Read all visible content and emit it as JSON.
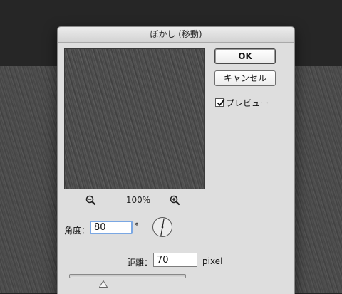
{
  "dialog": {
    "title": "ぼかし (移動)"
  },
  "buttons": {
    "ok_label": "OK",
    "cancel_label": "キャンセル"
  },
  "preview_toggle": {
    "label": "プレビュー",
    "checked": true
  },
  "zoom": {
    "level": "100%",
    "zoom_out_icon": "zoom-out-icon",
    "zoom_in_icon": "zoom-in-icon"
  },
  "angle": {
    "label": "角度：",
    "value": "80",
    "unit": "°"
  },
  "distance": {
    "label": "距離：",
    "value": "70",
    "unit": "pixel",
    "slider_fraction": 0.29
  },
  "colors": {
    "focus_ring": "#7aa7e3",
    "dialog_bg": "#dedede",
    "app_bg": "#262626"
  }
}
